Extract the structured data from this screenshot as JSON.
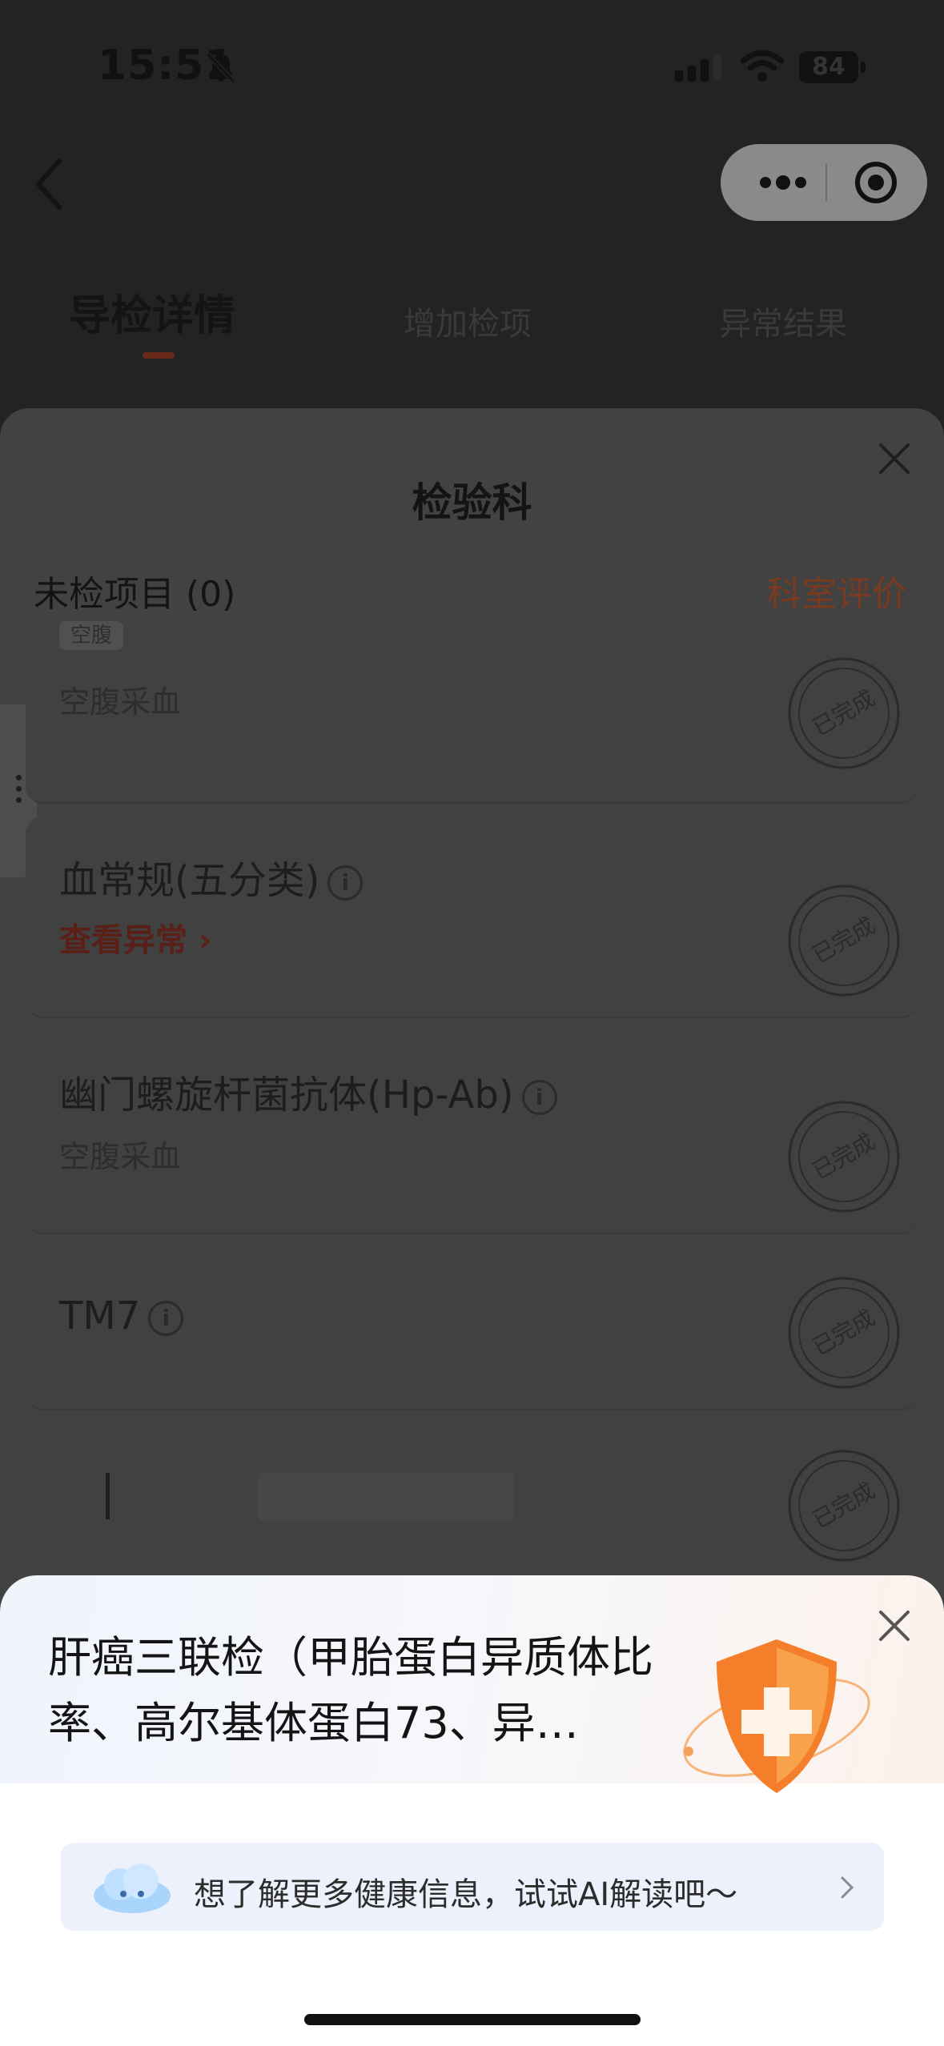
{
  "status_bar": {
    "time": "15:51",
    "battery": "84"
  },
  "tabs": [
    {
      "label": "导检详情",
      "active": true
    },
    {
      "label": "增加检项",
      "active": false
    },
    {
      "label": "异常结果",
      "active": false
    }
  ],
  "sheet": {
    "title": "检验科",
    "pending_label": "未检项目 (0)",
    "rate_label": "科室评价",
    "items": [
      {
        "partial_tag": "空腹",
        "name": "",
        "sub": "空腹采血",
        "stamp": "已完成"
      },
      {
        "name": "血常规(五分类)",
        "abnormal": "查看异常",
        "stamp": "已完成"
      },
      {
        "name": "幽门螺旋杆菌抗体(Hp-Ab)",
        "sub": "空腹采血",
        "stamp": "已完成"
      },
      {
        "name": "TM7",
        "stamp": "已完成"
      },
      {
        "name": "",
        "stamp": "已完成"
      }
    ]
  },
  "popup": {
    "title": "肝癌三联检（甲胎蛋白异质体比率、高尔基体蛋白73、异…",
    "ai_prompt": "想了解更多健康信息，试试AI解读吧～"
  },
  "icons": [
    "bell-mute-icon",
    "signal-icon",
    "wifi-icon",
    "battery-icon",
    "back-icon",
    "more-icon",
    "target-icon",
    "close-icon",
    "info-icon",
    "stamp-icon",
    "shield-icon",
    "cloud-icon",
    "chevron-right-icon"
  ],
  "colors": {
    "accent": "#d9541f",
    "abnormal": "#d43a2a",
    "overlay": "#232324"
  }
}
